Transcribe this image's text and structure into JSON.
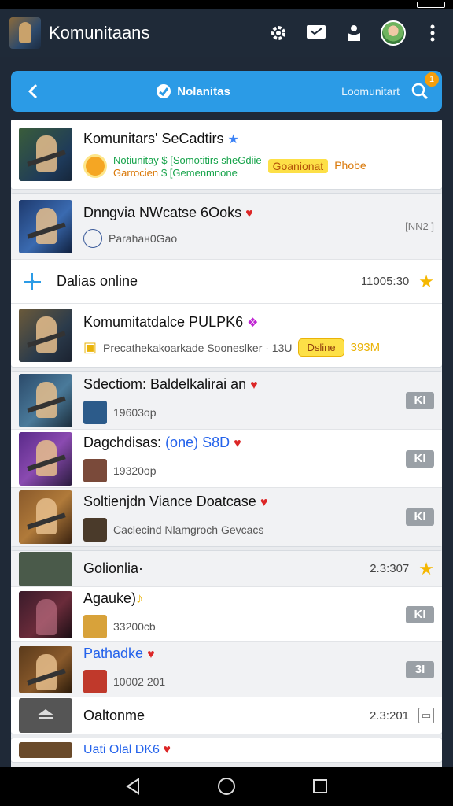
{
  "app": {
    "title": "Komunitaans"
  },
  "search": {
    "center_label": "Nolanitas",
    "right_label": "Loomunitart",
    "badge": "1"
  },
  "groups": [
    {
      "rows": [
        {
          "title": "Komunitars' SeCadtirs",
          "line1_green": "Notiunitay  $  [Somotitirs sheGdiie",
          "line1_hl": "Goanionat",
          "line1_orange": "Phobe",
          "line2_orange": "Garrocien",
          "line2_green": "$  [Gemenmnone"
        }
      ]
    },
    {
      "rows": [
        {
          "title": "Dnngvia NWcatse 6Ooks",
          "sub": "Parahaн0Gao",
          "right": "[NN2 ]"
        },
        {
          "title": "Dalias online",
          "right": "11005:30",
          "star": "★"
        },
        {
          "title": "Komumitatdalce PULPK6",
          "sub": "Precathekakoarkade Sooneslker · 13U",
          "pill": "Dsline",
          "pill_after": "393M"
        }
      ]
    },
    {
      "rows": [
        {
          "title": "Sdectiom: Baldelkalirai an",
          "sub": "19603op",
          "right": "KI"
        },
        {
          "title": "Dagchdisas: ",
          "title_paren": "(one) S8D",
          "sub": "19320op",
          "right": "KI"
        },
        {
          "title": "Soltienjdn Viance Doatcase",
          "sub": "Caclecind Nlamgroch Gevcacs",
          "right": "KI"
        }
      ]
    },
    {
      "rows": [
        {
          "title": "Golionlia·",
          "right": "2.3:307",
          "star": "★"
        },
        {
          "title": "Agauke)",
          "sub": "33200cb",
          "right": "KI"
        },
        {
          "title": "Pathadke",
          "sub": "10002 201",
          "right": "3I"
        },
        {
          "title": "Oaltonme",
          "right": "2.3:201"
        }
      ]
    },
    {
      "rows": [
        {
          "title": "Uati Olal DK6"
        }
      ]
    }
  ]
}
